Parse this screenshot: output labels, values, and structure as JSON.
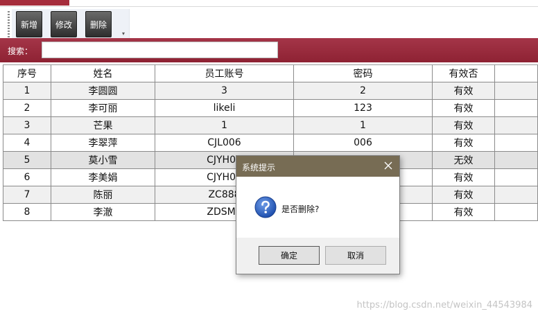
{
  "toolbar": {
    "add_label": "新增",
    "edit_label": "修改",
    "delete_label": "删除",
    "overflow_glyph": "▾"
  },
  "search": {
    "label": "搜索：",
    "value": ""
  },
  "grid": {
    "columns": [
      "序号",
      "姓名",
      "员工账号",
      "密码",
      "有效否",
      ""
    ],
    "rows": [
      [
        "1",
        "李圆圆",
        "3",
        "2",
        "有效",
        ""
      ],
      [
        "2",
        "李可丽",
        "likeli",
        "123",
        "有效",
        ""
      ],
      [
        "3",
        "芒果",
        "1",
        "1",
        "有效",
        ""
      ],
      [
        "4",
        "李翠萍",
        "CJL006",
        "006",
        "有效",
        ""
      ],
      [
        "5",
        "莫小雪",
        "CJYH00",
        "",
        "无效",
        ""
      ],
      [
        "6",
        "李美娟",
        "CJYH00",
        "",
        "有效",
        ""
      ],
      [
        "7",
        "陈丽",
        "ZC888",
        "",
        "有效",
        ""
      ],
      [
        "8",
        "李澈",
        "ZDSM0",
        "",
        "有效",
        ""
      ]
    ],
    "selected_row": 5
  },
  "dialog": {
    "title": "系统提示",
    "message": "是否删除?",
    "ok_label": "确定",
    "cancel_label": "取消",
    "icon": "question-icon"
  },
  "watermark": "https://blog.csdn.net/weixin_44543984",
  "colors": {
    "accent_red": "#9a2b3c",
    "dialog_title": "#776c54"
  }
}
